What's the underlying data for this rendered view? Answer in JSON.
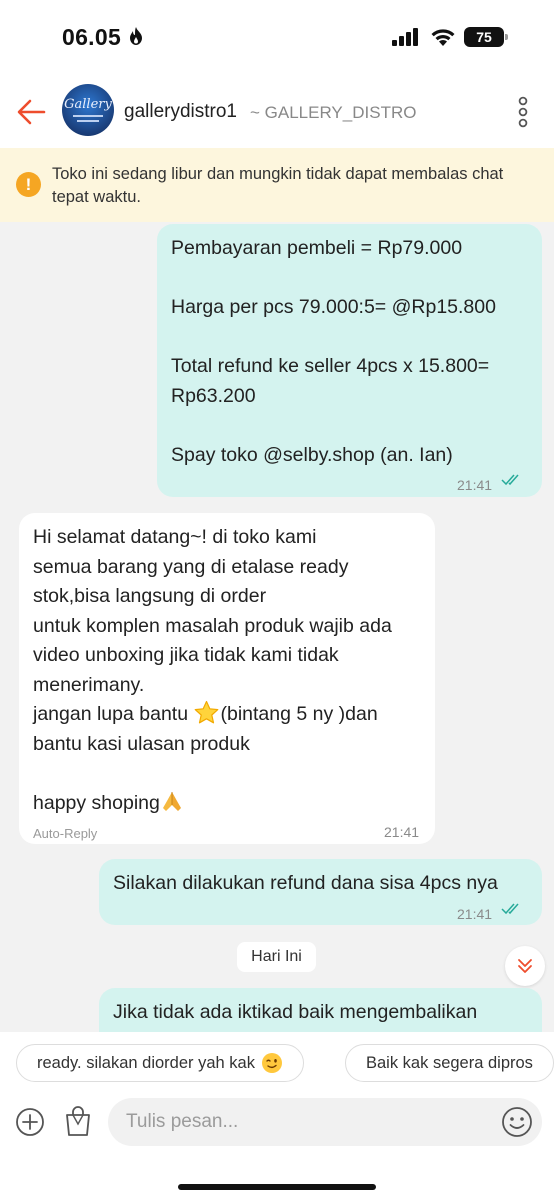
{
  "status_bar": {
    "time": "06.05",
    "battery": "75"
  },
  "header": {
    "shop_name": "gallerydistro1",
    "shop_username": "~ GALLERY_DISTRO",
    "avatar_text": "Gallery"
  },
  "notice": {
    "text": "Toko ini sedang libur dan mungkin tidak dapat membalas chat tepat waktu."
  },
  "messages": [
    {
      "direction": "outgoing",
      "text": "Pembayaran pembeli = Rp79.000\n\nHarga per pcs 79.000:5= @Rp15.800\n\nTotal refund ke seller 4pcs x 15.800=\nRp63.200\n\nSpay toko @selby.shop (an. Ian)",
      "time": "21:41",
      "read": true
    },
    {
      "direction": "incoming",
      "text_part1": "Hi selamat datang~! di toko kami\nsemua barang yang di etalase ready\nstok,bisa langsung di order\nuntuk komplen masalah produk wajib ada\nvideo unboxing jika tidak kami tidak\nmenerimany.\njangan lupa bantu ",
      "text_part2": "(bintang 5 ny )dan\nbantu kasi ulasan produk\n\nhappy shoping",
      "label": "Auto-Reply",
      "time": "21:41"
    },
    {
      "direction": "outgoing",
      "text": "Silakan dilakukan refund dana sisa 4pcs nya",
      "time": "21:41",
      "read": true
    },
    {
      "direction": "outgoing",
      "text": "Jika tidak ada iktikad baik mengembalikan"
    }
  ],
  "date_separator": "Hari Ini",
  "quick_replies": [
    "ready. silakan diorder yah kak",
    "Baik kak segera dipros"
  ],
  "input": {
    "placeholder": "Tulis pesan..."
  },
  "colors": {
    "accent": "#ee4d2d",
    "outgoing_bubble": "#d4f3ef",
    "notice_bg": "#fdf6dd",
    "read_tick": "#26aa99"
  }
}
